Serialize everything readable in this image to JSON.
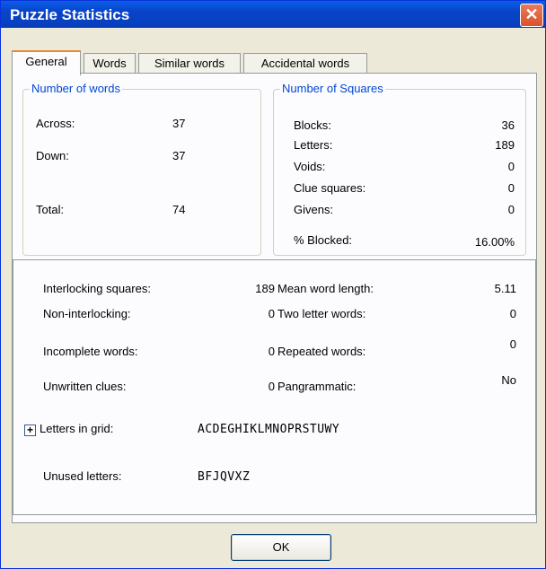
{
  "window": {
    "title": "Puzzle Statistics",
    "close": "✕"
  },
  "tabs": [
    "General",
    "Words",
    "Similar words",
    "Accidental words"
  ],
  "words": {
    "label": "Number of words",
    "across_label": "Across:",
    "across": "37",
    "down_label": "Down:",
    "down": "37",
    "total_label": "Total:",
    "total": "74"
  },
  "squares": {
    "label": "Number of Squares",
    "rows": [
      {
        "label": "Blocks:",
        "value": "36"
      },
      {
        "label": "Letters:",
        "value": "189"
      },
      {
        "label": "Voids:",
        "value": "0"
      },
      {
        "label": "Clue squares:",
        "value": "0"
      },
      {
        "label": "Givens:",
        "value": "0"
      }
    ],
    "blocked_label": "% Blocked:",
    "blocked": "16.00%"
  },
  "stats": {
    "left": [
      {
        "label": "Interlocking squares:",
        "value": "189"
      },
      {
        "label": "Non-interlocking:",
        "value": "0"
      },
      {
        "label": "Incomplete words:",
        "value": "0"
      },
      {
        "label": "Unwritten clues:",
        "value": "0"
      }
    ],
    "right": [
      {
        "label": "Mean word length:",
        "value": "5.11"
      },
      {
        "label": "Two letter words:",
        "value": "0"
      },
      {
        "label": "Repeated words:",
        "value": "0"
      },
      {
        "label": "Pangrammatic:",
        "value": "No"
      }
    ],
    "letters_label": "Letters in grid:",
    "letters": "ACDEGHIKLMNOPRSTUWY",
    "unused_label": "Unused letters:",
    "unused": "BFJQVXZ"
  },
  "ok_label": "OK"
}
